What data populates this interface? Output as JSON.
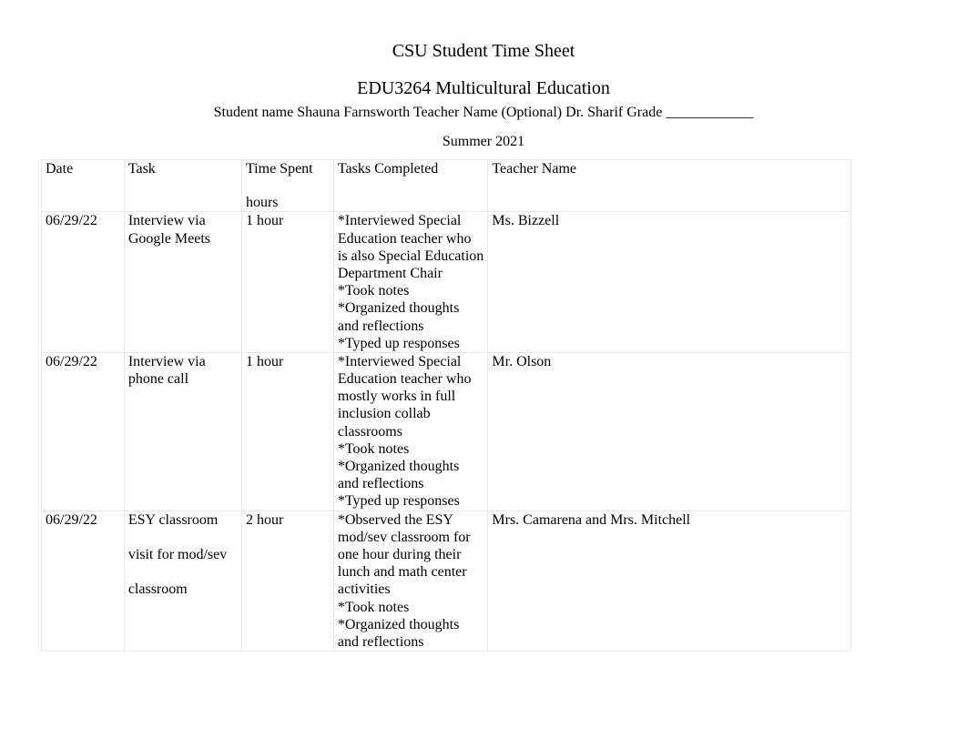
{
  "header": {
    "title1": "CSU Student Time Sheet",
    "title2": "EDU3264 Multicultural Education",
    "infoLine": "Student name Shauna Farnsworth   Teacher Name (Optional) Dr. Sharif   Grade ____________",
    "term": "Summer 2021"
  },
  "table": {
    "headers": {
      "date": "Date",
      "task": "Task",
      "timeSpent": "Time Spent",
      "timeSpentSub": "hours",
      "tasksCompleted": "Tasks Completed",
      "teacherName": "Teacher Name"
    },
    "rows": [
      {
        "date": "06/29/22",
        "task": "Interview via Google Meets",
        "time": "1 hour",
        "completed": "*Interviewed Special Education teacher who is also Special Education Department Chair\n*Took notes\n*Organized thoughts and reflections\n*Typed up responses",
        "teacher": "Ms. Bizzell"
      },
      {
        "date": " 06/29/22",
        "task": " Interview via phone call",
        "time": " 1 hour",
        "completed": " *Interviewed Special Education teacher who mostly works in full inclusion collab classrooms\n*Took notes\n*Organized thoughts and reflections\n*Typed up responses",
        "teacher": " Mr. Olson"
      },
      {
        "date": " 06/29/22",
        "task": " ESY classroom\n\nvisit for mod/sev\n\nclassroom",
        "time": " 2 hour",
        "completed": " *Observed the ESY mod/sev classroom for one hour during their lunch and math center activities\n*Took notes\n*Organized thoughts and reflections",
        "teacher": " Mrs. Camarena and Mrs. Mitchell"
      }
    ]
  }
}
